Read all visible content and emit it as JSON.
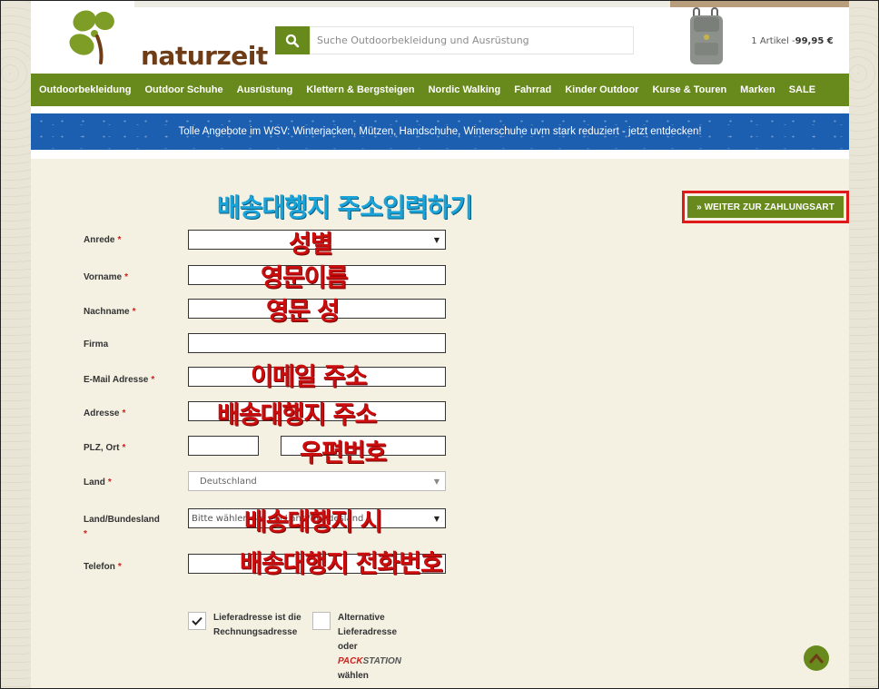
{
  "header": {
    "logo_text": "naturzeit",
    "search_placeholder": "Suche Outdoorbekleidung und Ausrüstung",
    "cart_count": "1 Artikel - ",
    "cart_total": "99,95 €"
  },
  "nav": {
    "items": [
      "Outdoorbekleidung",
      "Outdoor Schuhe",
      "Ausrüstung",
      "Klettern & Bergsteigen",
      "Nordic Walking",
      "Fahrrad",
      "Kinder Outdoor",
      "Kurse & Touren",
      "Marken",
      "SALE"
    ]
  },
  "banner": {
    "text": "Tolle Angebote im WSV: Winterjacken, Mützen, Handschuhe, Winterschuhe uvm stark reduziert - jetzt entdecken!"
  },
  "annotations": {
    "title": "배송대행지 주소입력하기",
    "anrede": "성별",
    "vorname": "영문이름",
    "nachname": "영문 성",
    "email": "이메일 주소",
    "adresse": "배송대행지 주소",
    "plz": "우편번호",
    "bundesland": "배송대행지 시",
    "telefon": "배송대행지 전화번호"
  },
  "form": {
    "submit_label": "»  WEITER ZUR ZAHLUNGSART",
    "required_mark": "*",
    "anrede_label": "Anrede",
    "vorname_label": "Vorname",
    "nachname_label": "Nachname",
    "firma_label": "Firma",
    "email_label": "E-Mail Adresse",
    "adresse_label": "Adresse",
    "plz_label": "PLZ, Ort",
    "land_label": "Land",
    "land_value": "Deutschland",
    "bundesland_label": "Land/Bundesland",
    "bundesland_value": "Bitte wählen Sie ein Land/Bundesland",
    "telefon_label": "Telefon",
    "checkbox1_label": "Lieferadresse ist die Rechnungsadresse",
    "checkbox2_label": "Alternative Lieferadresse oder",
    "packstation_prefix": "PACK",
    "packstation_suffix": "STATION",
    "checkbox2_suffix": "wählen"
  },
  "colors": {
    "brand_green": "#688a1d",
    "banner_blue": "#1c5eb0",
    "annotation_red": "#cc0d0d",
    "annotation_blue": "#19a3d9",
    "highlight_red": "#e01a1a"
  }
}
